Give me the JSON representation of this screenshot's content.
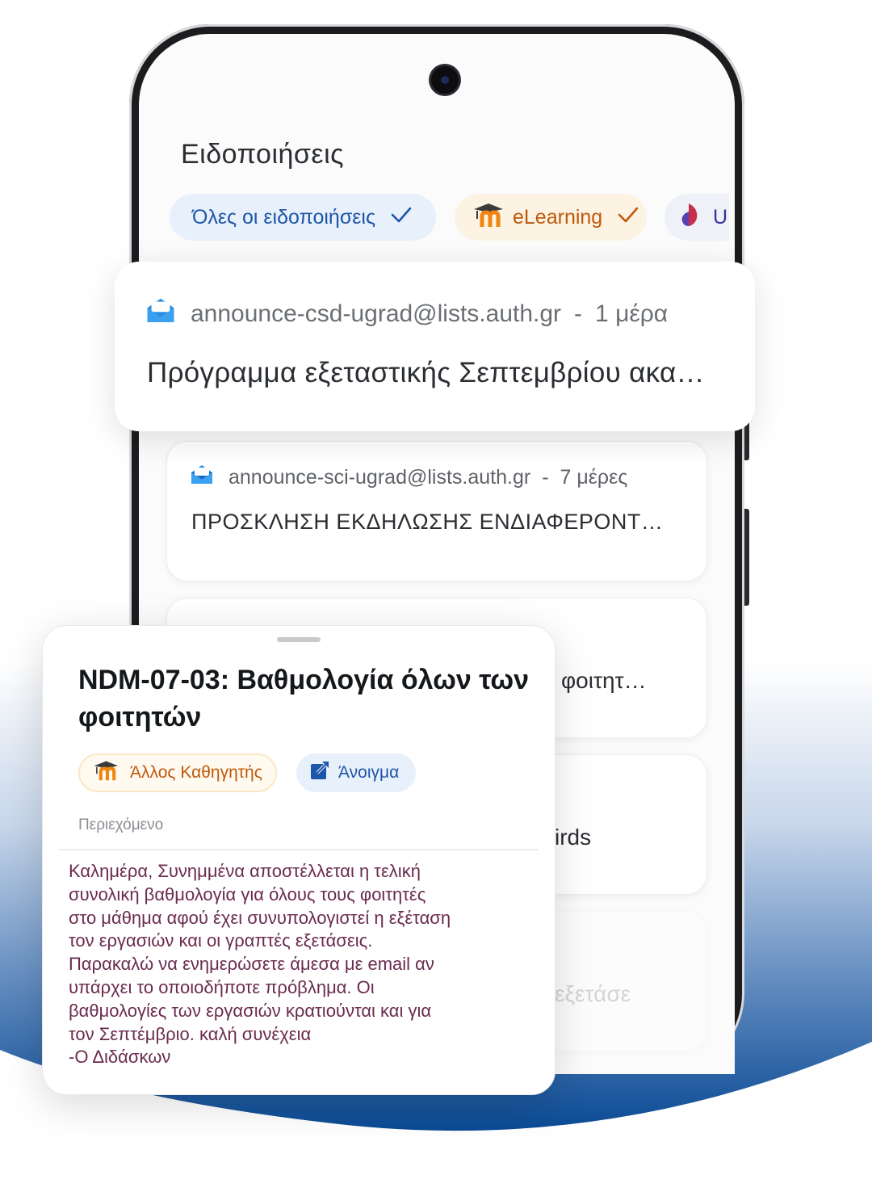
{
  "screen": {
    "title": "Ειδοποιήσεις"
  },
  "filters": [
    {
      "label": "Όλες οι ειδοποιήσεις",
      "selected": true,
      "icon": "check-icon"
    },
    {
      "label": "eLearning",
      "selected": true,
      "icon": "moodle-logo-icon"
    },
    {
      "label": "U",
      "selected": false,
      "icon": "app-logo-icon"
    }
  ],
  "highlighted_notification": {
    "sender": "announce-csd-ugrad@lists.auth.gr",
    "separator": "-",
    "time": "1 μέρα",
    "title": "Πρόγραμμα εξεταστικής Σεπτεμβρίου ακα…"
  },
  "notifications": [
    {
      "sender": "announce-sci-ugrad@lists.auth.gr",
      "separator": "-",
      "time": "7 μέρες",
      "title": "ΠΡΟΣΚΛΗΣΗ ΕΚΔΗΛΩΣΗΣ ΕΝΔΙΑΦΕΡΟΝΤ…"
    },
    {
      "partial_text": "φοιτητ…"
    },
    {
      "partial_text": "irds"
    },
    {
      "partial_text": "εξετάσε"
    }
  ],
  "sheet": {
    "title": "NDM-07-03: Βαθμολογία όλων των φοιτητών",
    "source_chip": "Άλλος Καθηγητής",
    "open_chip": "Άνοιγμα",
    "section_label": "Περιεχόμενο",
    "body": "Καλημέρα, Συνημμένα αποστέλλεται η τελική\nσυνολική βαθμολογία για όλους τους φοιτητές\nστο μάθημα αφού έχει συνυπολογιστεί η εξέταση\nτον εργασιών και οι γραπτές εξετάσεις.\nΠαρακαλώ να ενημερώσετε άμεσα με email αν\nυπάρχει το οποιοδήποτε πρόβλημα. Οι\nβαθμολογίες των εργασιών κρατιούνται και για\nτον Σεπτέμβριο. καλή συνέχεια\n-Ο Διδάσκων"
  },
  "colors": {
    "accent_blue": "#1d56a8",
    "elearning_orange": "#c0580c",
    "body_text": "#6b2b4e",
    "wave_dark": "#0a4a94"
  }
}
